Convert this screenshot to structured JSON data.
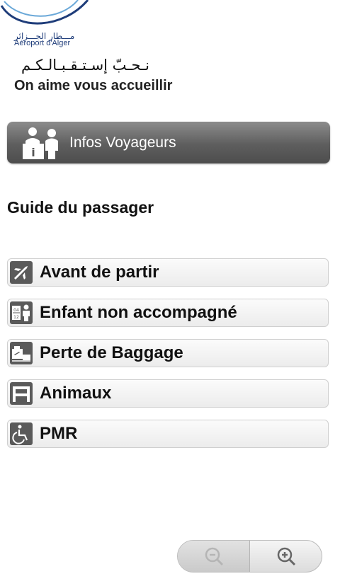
{
  "header": {
    "logo_arabic": "مـــطار الجـــزائر",
    "logo_french": "Aéroport d'Alger",
    "tagline_arabic": "نـحـبّ إسـتـقـبـالـكـم",
    "tagline_french": "On aime vous accueillir"
  },
  "infos_bar": {
    "label": "Infos Voyageurs",
    "icon": "info-desk-icon"
  },
  "section": {
    "title": "Guide du passager"
  },
  "menu": {
    "items": [
      {
        "label": "Avant de partir",
        "icon": "plane-icon"
      },
      {
        "label": "Enfant non accompagné",
        "icon": "calendar-child-icon"
      },
      {
        "label": "Perte de Baggage",
        "icon": "baggage-icon"
      },
      {
        "label": "Animaux",
        "icon": "animal-icon"
      },
      {
        "label": "PMR",
        "icon": "wheelchair-icon"
      }
    ]
  },
  "zoom": {
    "out_icon": "zoom-out-icon",
    "in_icon": "zoom-in-icon"
  },
  "colors": {
    "bar_dark": "#5e5e5e",
    "logo_blue": "#1f3d7a",
    "swoosh": "#6aa8d8"
  }
}
